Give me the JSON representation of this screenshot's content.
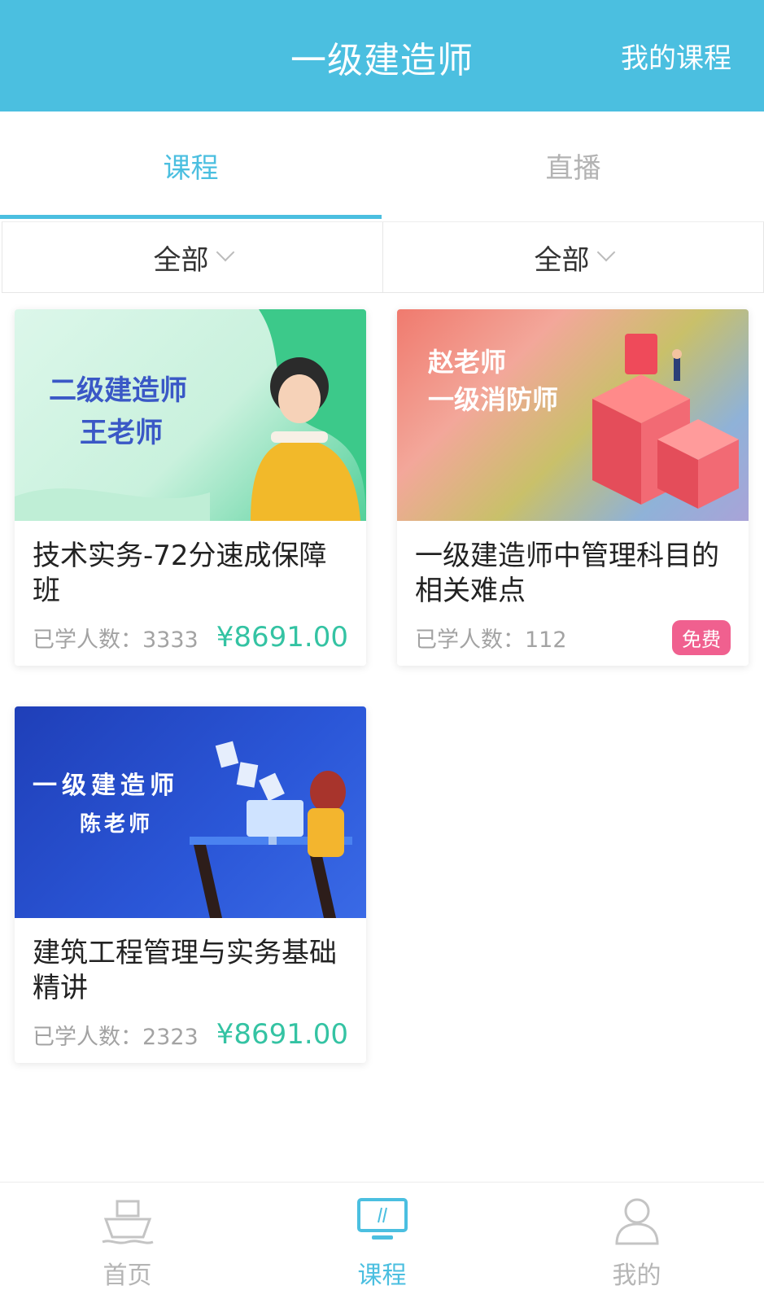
{
  "header": {
    "title": "一级建造师",
    "right_link": "我的课程"
  },
  "tabs": [
    {
      "label": "课程"
    },
    {
      "label": "直播"
    }
  ],
  "filters": [
    {
      "label": "全部"
    },
    {
      "label": "全部"
    }
  ],
  "courses": [
    {
      "name": "技术实务-72分速成保障班",
      "learners": "已学人数：3333",
      "price": "¥8691.00",
      "thumb_line1": "二级建造师",
      "thumb_line2": "王老师"
    },
    {
      "name": "一级建造师中管理科目的相关难点",
      "learners": "已学人数：112",
      "badge": "免费",
      "thumb_line1": "赵老师",
      "thumb_line2": "一级消防师"
    },
    {
      "name": "建筑工程管理与实务基础精讲",
      "learners": "已学人数：2323",
      "price": "¥8691.00",
      "thumb_line1": "一级建造师",
      "thumb_line2": "陈老师"
    }
  ],
  "bottom_nav": [
    {
      "label": "首页",
      "icon": "ship-icon"
    },
    {
      "label": "课程",
      "icon": "monitor-icon"
    },
    {
      "label": "我的",
      "icon": "user-icon"
    }
  ],
  "colors": {
    "accent": "#4bbfe0",
    "price": "#34c3a3",
    "badge": "#f0608f"
  }
}
